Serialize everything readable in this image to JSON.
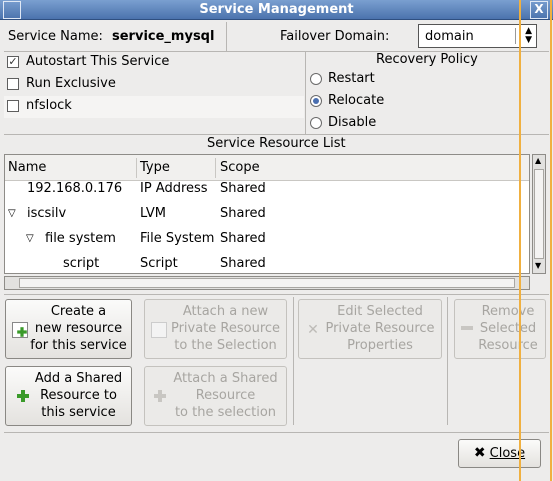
{
  "window": {
    "title": "Service Management",
    "close_glyph": "X"
  },
  "header": {
    "service_name_label": "Service Name:",
    "service_name_value": "service_mysql",
    "failover_label": "Failover Domain:",
    "failover_value": "domain"
  },
  "options": {
    "autostart": {
      "label": "Autostart This Service",
      "checked": true
    },
    "run_exclusive": {
      "label": "Run Exclusive",
      "checked": false
    },
    "nfslock": {
      "label": "nfslock",
      "checked": false
    }
  },
  "recovery": {
    "title": "Recovery Policy",
    "items": [
      {
        "label": "Restart",
        "selected": false
      },
      {
        "label": "Relocate",
        "selected": true
      },
      {
        "label": "Disable",
        "selected": false
      }
    ]
  },
  "resources": {
    "title": "Service Resource List",
    "columns": [
      "Name",
      "Type",
      "Scope"
    ],
    "rows": [
      {
        "name": "192.168.0.176",
        "type": "IP Address",
        "scope": "Shared"
      },
      {
        "name": "iscsilv",
        "type": "LVM",
        "scope": "Shared"
      },
      {
        "name": "file system",
        "type": "File System",
        "scope": "Shared"
      },
      {
        "name": "script",
        "type": "Script",
        "scope": "Shared"
      }
    ]
  },
  "buttons": {
    "create": "Create a\nnew resource\nfor this service",
    "attach_private": "Attach a new\nPrivate Resource\nto the Selection",
    "edit_selected": "Edit Selected\nPrivate Resource\nProperties",
    "remove_selected": "Remove\nSelected\nResource",
    "add_shared": "Add a Shared\nResource to\nthis service",
    "attach_shared": "Attach a Shared\nResource\nto the selection",
    "close": "Close"
  }
}
